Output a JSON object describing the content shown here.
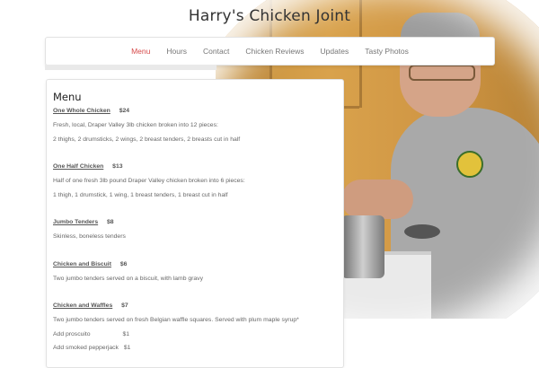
{
  "site": {
    "title": "Harry's Chicken Joint"
  },
  "nav": {
    "items": [
      {
        "label": "Menu",
        "active": true
      },
      {
        "label": "Hours",
        "active": false
      },
      {
        "label": "Contact",
        "active": false
      },
      {
        "label": "Chicken Reviews",
        "active": false
      },
      {
        "label": "Updates",
        "active": false
      },
      {
        "label": "Tasty Photos",
        "active": false
      }
    ],
    "active_color": "#d64a4a"
  },
  "menu": {
    "heading": "Menu",
    "items": [
      {
        "name": "One Whole Chicken",
        "price": "$24",
        "lines": [
          "Fresh, local, Draper Valley 3lb chicken broken into 12 pieces:",
          "2 thighs, 2 drumsticks, 2 wings, 2 breast tenders, 2 breasts cut in half"
        ]
      },
      {
        "name": "One Half Chicken",
        "price": "$13",
        "lines": [
          "Half of one fresh 3lb pound Draper Valley chicken broken into 6 pieces:",
          "1 thigh, 1 drumstick, 1 wing, 1 breast tenders, 1 breast cut in half"
        ]
      },
      {
        "name": "Jumbo Tenders",
        "price": "$8",
        "lines": [
          "Skinless, boneless tenders"
        ]
      },
      {
        "name": "Chicken and Biscuit",
        "price": "$6",
        "lines": [
          "Two jumbo tenders served on a biscuit, with lamb gravy"
        ]
      },
      {
        "name": "Chicken and Waffles",
        "price": "$7",
        "lines": [
          "Two jumbo tenders served on fresh Belgian waffle squares.  Served with plum maple syrup*"
        ]
      }
    ],
    "addons": [
      {
        "label": "Add proscuito",
        "price": "$1"
      },
      {
        "label": "Add smoked pepperjack",
        "price": "$1"
      }
    ]
  }
}
